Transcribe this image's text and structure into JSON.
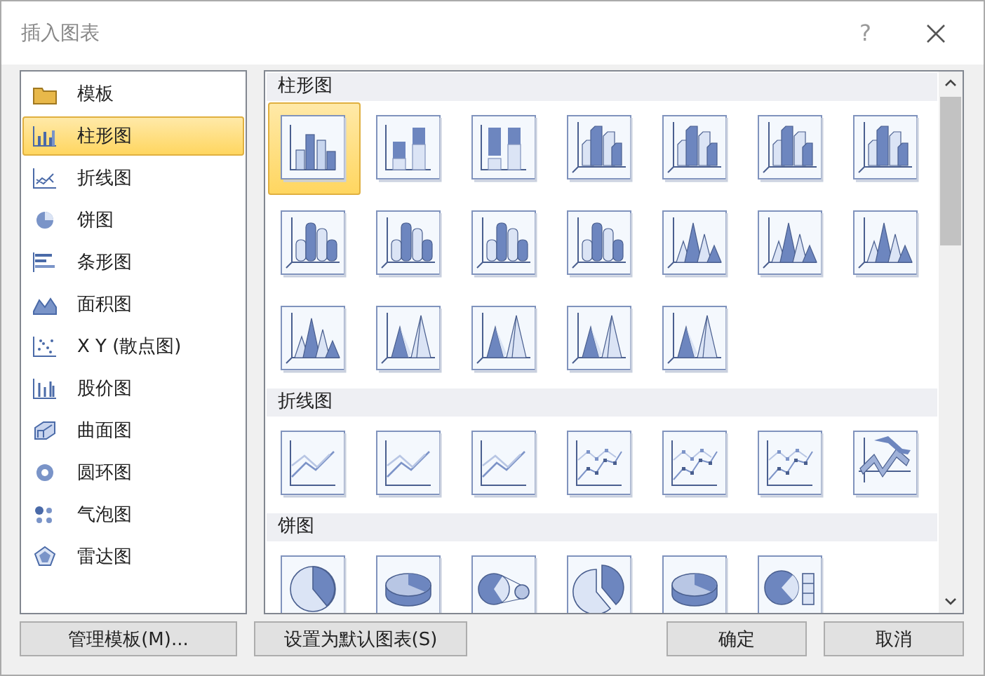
{
  "window": {
    "title": "插入图表",
    "help": "?"
  },
  "sidebar": {
    "items": [
      {
        "label": "模板",
        "kind": "folder",
        "selected": false
      },
      {
        "label": "柱形图",
        "kind": "column",
        "selected": true
      },
      {
        "label": "折线图",
        "kind": "line",
        "selected": false
      },
      {
        "label": "饼图",
        "kind": "pie",
        "selected": false
      },
      {
        "label": "条形图",
        "kind": "bar",
        "selected": false
      },
      {
        "label": "面积图",
        "kind": "area",
        "selected": false
      },
      {
        "label": "X Y (散点图)",
        "kind": "scatter",
        "selected": false
      },
      {
        "label": "股价图",
        "kind": "stock",
        "selected": false
      },
      {
        "label": "曲面图",
        "kind": "surface",
        "selected": false
      },
      {
        "label": "圆环图",
        "kind": "doughnut",
        "selected": false
      },
      {
        "label": "气泡图",
        "kind": "bubble",
        "selected": false
      },
      {
        "label": "雷达图",
        "kind": "radar",
        "selected": false
      }
    ]
  },
  "gallery": {
    "sections": [
      {
        "title": "柱形图",
        "items": [
          {
            "kind": "column",
            "selected": true
          },
          {
            "kind": "stacked",
            "selected": false
          },
          {
            "kind": "stacked100",
            "selected": false
          },
          {
            "kind": "column3d",
            "selected": false
          },
          {
            "kind": "stacked3d",
            "selected": false
          },
          {
            "kind": "stacked3d",
            "selected": false
          },
          {
            "kind": "column3d",
            "selected": false
          },
          {
            "kind": "cylinder",
            "selected": false
          },
          {
            "kind": "cylinder",
            "selected": false
          },
          {
            "kind": "cylinder",
            "selected": false
          },
          {
            "kind": "cylinder",
            "selected": false
          },
          {
            "kind": "cone",
            "selected": false
          },
          {
            "kind": "cone",
            "selected": false
          },
          {
            "kind": "cone",
            "selected": false
          },
          {
            "kind": "cone",
            "selected": false
          },
          {
            "kind": "pyramid",
            "selected": false
          },
          {
            "kind": "pyramid",
            "selected": false
          },
          {
            "kind": "pyramid",
            "selected": false
          },
          {
            "kind": "pyramid",
            "selected": false
          }
        ]
      },
      {
        "title": "折线图",
        "items": [
          {
            "kind": "line",
            "selected": false
          },
          {
            "kind": "line",
            "selected": false
          },
          {
            "kind": "line",
            "selected": false
          },
          {
            "kind": "line-markers",
            "selected": false
          },
          {
            "kind": "line-markers",
            "selected": false
          },
          {
            "kind": "line-markers",
            "selected": false
          },
          {
            "kind": "line3d",
            "selected": false
          }
        ]
      },
      {
        "title": "饼图",
        "items": [
          {
            "kind": "pie",
            "selected": false
          },
          {
            "kind": "pie3d",
            "selected": false
          },
          {
            "kind": "pie-of-pie",
            "selected": false
          },
          {
            "kind": "pie-exploded",
            "selected": false
          },
          {
            "kind": "pie3d",
            "selected": false
          },
          {
            "kind": "bar-of-pie",
            "selected": false
          }
        ]
      }
    ]
  },
  "buttons": {
    "left": [
      "管理模板(M)...",
      "设置为默认图表(S)"
    ],
    "right": [
      "确定",
      "取消"
    ]
  }
}
